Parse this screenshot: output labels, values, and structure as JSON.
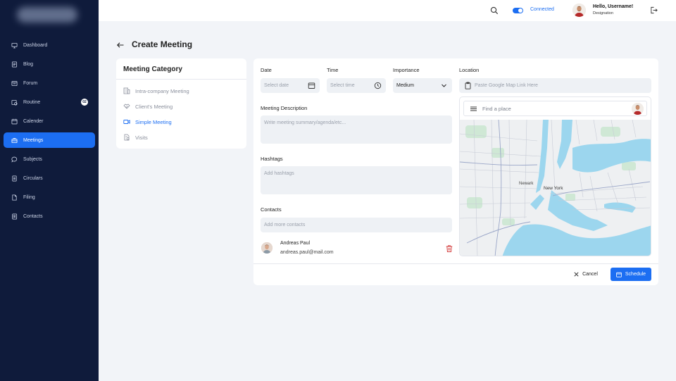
{
  "sidebar": {
    "items": [
      {
        "label": "Dashboard",
        "icon": "monitor-icon"
      },
      {
        "label": "Blog",
        "icon": "blog-icon"
      },
      {
        "label": "Forum",
        "icon": "forum-icon"
      },
      {
        "label": "Routine",
        "icon": "routine-icon",
        "badge": "02"
      },
      {
        "label": "Calender",
        "icon": "calendar-icon"
      },
      {
        "label": "Meetings",
        "icon": "briefcase-icon",
        "active": true
      },
      {
        "label": "Subjects",
        "icon": "chat-icon"
      },
      {
        "label": "Circulars",
        "icon": "document-icon"
      },
      {
        "label": "Filing",
        "icon": "file-icon"
      },
      {
        "label": "Contacts",
        "icon": "contacts-icon"
      }
    ]
  },
  "topbar": {
    "status": "Connected",
    "greeting": "Hello, Username!",
    "designation": "Designation"
  },
  "page": {
    "title": "Create Meeting"
  },
  "category": {
    "title": "Meeting Category",
    "items": [
      {
        "label": "Intra-company Meeting"
      },
      {
        "label": "Client's Meeting"
      },
      {
        "label": "Simple Meeting",
        "active": true
      },
      {
        "label": "Visits"
      }
    ]
  },
  "form": {
    "date_label": "Date",
    "date_placeholder": "Select date",
    "time_label": "Time",
    "time_placeholder": "Select time",
    "importance_label": "Importance",
    "importance_value": "Medium",
    "location_label": "Location",
    "location_placeholder": "Paste Google Map Link Here",
    "description_label": "Meeting Description",
    "description_placeholder": "Write meeting summary/agenda/etc...",
    "hashtags_label": "Hashtags",
    "hashtags_placeholder": "Add hashtags",
    "contacts_label": "Contacts",
    "contacts_placeholder": "Add more contacts",
    "contact": {
      "name": "Andreas Paul",
      "email": "andreas.paul@mail.com"
    },
    "cancel_label": "Cancel",
    "schedule_label": "Schedule"
  },
  "map": {
    "search_placeholder": "Find a place",
    "labels": [
      "Newark",
      "New York"
    ]
  },
  "colors": {
    "accent": "#1c6ef2",
    "sidebar": "#0f1b3b",
    "water": "#9cd6ee",
    "land": "#eef0f2"
  }
}
